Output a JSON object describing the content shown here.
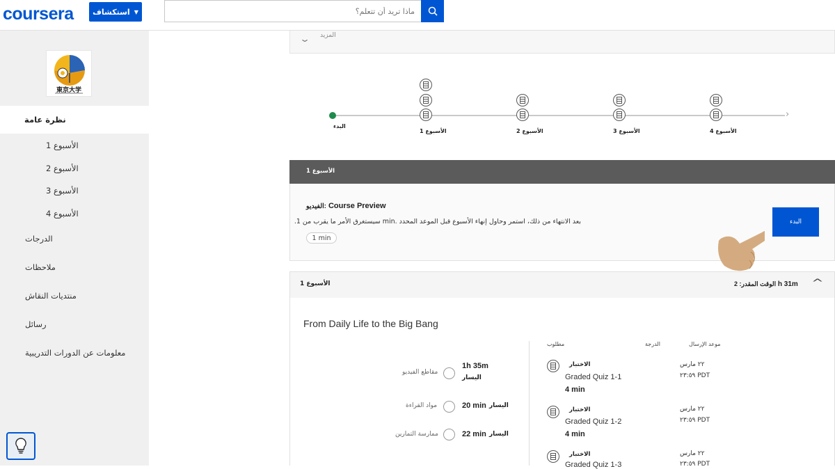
{
  "header": {
    "logo": "coursera",
    "explore_label": "استكشاف",
    "search_placeholder": "ماذا تريد أن تتعلم؟"
  },
  "sidebar": {
    "university_logo_text": "東京大学",
    "overview": "نظرة عامة",
    "weeks": [
      "الأسبوع 1",
      "الأسبوع 2",
      "الأسبوع 3",
      "الأسبوع 4"
    ],
    "links": [
      "الدرجات",
      "ملاحظات",
      "منتديات النقاش",
      "رسائل",
      "معلومات عن الدورات التدريبية"
    ]
  },
  "main": {
    "more_label": "المزيد",
    "timeline": {
      "start": "البدء",
      "weeks": [
        "الأسبوع 1",
        "الأسبوع 2",
        "الأسبوع 3",
        "الأسبوع 4"
      ]
    },
    "week_bar_title": "الأسبوع 1",
    "preview": {
      "title_label": "الفيديو:",
      "title": "Course Preview",
      "description": "بعد الانتهاء من ذلك، استمر وحاول إنهاء الأسبوع قبل الموعد المحدد .min سيستغرق الأمر ما يقرب من 1.",
      "duration": "1 min",
      "start_button": "البدء"
    },
    "week_section": {
      "title": "الأسبوع 1",
      "estimated_label": "الوقت المقدر: 2",
      "estimated_value": "h 31m",
      "heading": "From Daily Life to the Big Bang",
      "summary": [
        {
          "label": "مقاطع الفيديو",
          "time": "1h 35m",
          "left": "اليسار"
        },
        {
          "label": "مواد القراءة",
          "time": "20 min",
          "left": "اليسار"
        },
        {
          "label": "ممارسة التمارين",
          "time": "22 min",
          "left": "اليسار"
        }
      ],
      "table_headers": {
        "required": "مطلوب",
        "grade": "الدرجة",
        "due": "موعد الإرسال"
      },
      "items": [
        {
          "type": "الاختبار",
          "name": "Graded Quiz 1-1",
          "duration": "4 min",
          "due_date": "٢٢ مارس",
          "due_time": "٢٣:٥٩ PDT"
        },
        {
          "type": "الاختبار",
          "name": "Graded Quiz 1-2",
          "duration": "4 min",
          "due_date": "٢٢ مارس",
          "due_time": "٢٣:٥٩ PDT"
        },
        {
          "type": "الاختبار",
          "name": "Graded Quiz 1-3",
          "duration": "",
          "due_date": "٢٢ مارس",
          "due_time": "٢٣:٥٩ PDT"
        }
      ]
    }
  },
  "colors": {
    "brand": "#0056d2",
    "week_bar": "#5b5b5b",
    "sidebar": "#f0f0f0",
    "timeline_dot": "#1e8a4c",
    "hand": "#d2a679"
  }
}
